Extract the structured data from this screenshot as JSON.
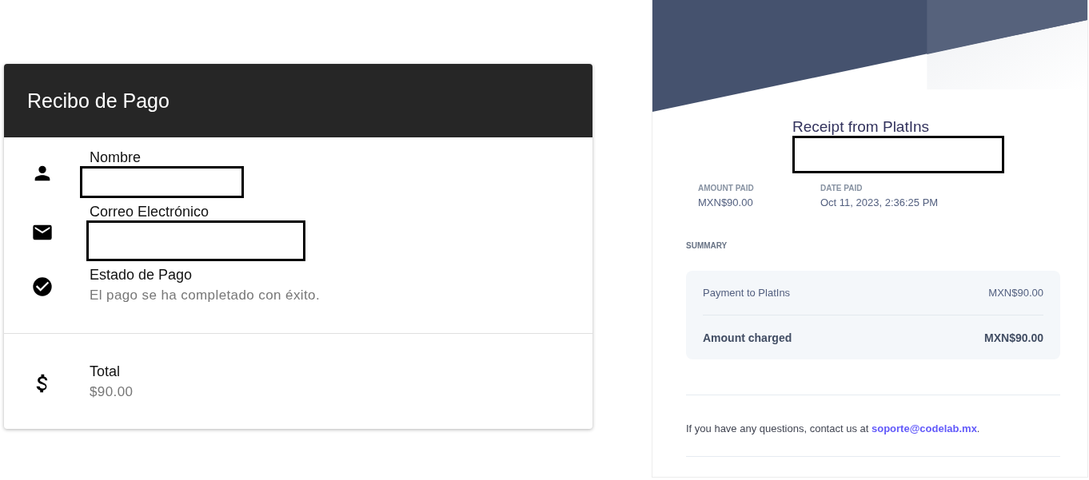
{
  "receipt_card": {
    "title": "Recibo de Pago",
    "items": [
      {
        "kind": "person",
        "label": "Nombre",
        "redacted": true
      },
      {
        "kind": "mail",
        "label": "Correo Electrónico",
        "redacted": true
      },
      {
        "kind": "check",
        "label": "Estado de Pago",
        "value": "El pago se ha completado con éxito."
      }
    ],
    "total": {
      "kind": "dollar",
      "label": "Total",
      "value": "$90.00"
    }
  },
  "email_receipt": {
    "title": "Receipt from PlatIns",
    "recipient_redacted": true,
    "details": [
      {
        "label": "AMOUNT PAID",
        "value": "MXN$90.00"
      },
      {
        "label": "DATE PAID",
        "value": "Oct 11, 2023, 2:36:25 PM"
      }
    ],
    "summary_heading": "SUMMARY",
    "summary_rows": [
      {
        "label": "Payment to PlatIns",
        "amount": "MXN$90.00",
        "emphasis": false
      },
      {
        "label": "Amount charged",
        "amount": "MXN$90.00",
        "emphasis": true
      }
    ],
    "contact": {
      "text": "If you have any questions, contact us at ",
      "email": "soporte@codelab.mx",
      "end": "."
    }
  }
}
